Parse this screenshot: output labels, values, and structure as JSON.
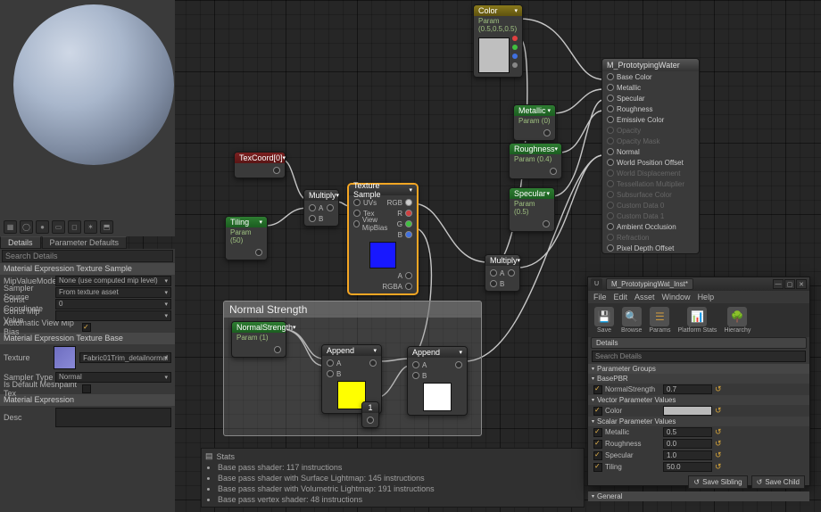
{
  "tabs": {
    "details": "Details",
    "param_defaults": "Parameter Defaults"
  },
  "search_placeholder": "Search Details",
  "left_panel": {
    "sec_tex_sample": "Material Expression Texture Sample",
    "mip_value_mode": {
      "label": "MipValueMode",
      "value": "None (use computed mip level)"
    },
    "sampler_source": {
      "label": "Sampler Source",
      "value": "From texture asset"
    },
    "const_coord": {
      "label": "Const Coordinate",
      "value": "0"
    },
    "const_mip": {
      "label": "Const Mip Value",
      "value": ""
    },
    "auto_view_mip": {
      "label": "Automatic View Mip Bias",
      "checked": true
    },
    "sec_tex_base": "Material Expression Texture Base",
    "texture": {
      "label": "Texture",
      "value": "Fabric01Trim_detailnormal"
    },
    "sampler_type": {
      "label": "Sampler Type",
      "value": "Normal"
    },
    "is_default_meshpaint": {
      "label": "Is Default Meshpaint Tex",
      "checked": false
    },
    "sec_mat_expr": "Material Expression",
    "desc": {
      "label": "Desc"
    }
  },
  "nodes": {
    "color": {
      "title": "Color",
      "sub": "Param (0.5,0.5,0.5)"
    },
    "metallic": {
      "title": "Metallic",
      "sub": "Param (0)"
    },
    "roughness": {
      "title": "Roughness",
      "sub": "Param (0.4)"
    },
    "specular": {
      "title": "Specular",
      "sub": "Param (0.5)"
    },
    "texcoord": {
      "title": "TexCoord[0]"
    },
    "tiling": {
      "title": "Tiling",
      "sub": "Param (50)"
    },
    "multiply1": {
      "title": "Multiply"
    },
    "multiply2": {
      "title": "Multiply"
    },
    "texsample": {
      "title": "Texture Sample",
      "in": [
        "UVs",
        "Tex",
        "View MipBias"
      ],
      "out": [
        "RGB",
        "R",
        "G",
        "B",
        "A",
        "RGBA"
      ]
    },
    "normstr": {
      "title": "NormalStrength",
      "sub": "Param (1)"
    },
    "append1": {
      "title": "Append"
    },
    "append2": {
      "title": "Append"
    },
    "one": {
      "title": "1"
    },
    "groupbox": "Normal Strength"
  },
  "result": {
    "title": "M_PrototypingWater",
    "pins": [
      "Base Color",
      "Metallic",
      "Specular",
      "Roughness",
      "Emissive Color",
      "Opacity",
      "Opacity Mask",
      "Normal",
      "World Position Offset",
      "World Displacement",
      "Tessellation Multiplier",
      "Subsurface Color",
      "Custom Data 0",
      "Custom Data 1",
      "Ambient Occlusion",
      "Refraction",
      "Pixel Depth Offset"
    ],
    "disabled": [
      5,
      6,
      9,
      10,
      11,
      12,
      13,
      15
    ]
  },
  "stats": {
    "title": "Stats",
    "lines": [
      "Base pass shader: 117 instructions",
      "Base pass shader with Surface Lightmap: 145 instructions",
      "Base pass shader with Volumetric Lightmap: 191 instructions",
      "Base pass vertex shader: 48 instructions"
    ]
  },
  "instance": {
    "tab_title": "M_PrototypingWat_Inst*",
    "menu": [
      "File",
      "Edit",
      "Asset",
      "Window",
      "Help"
    ],
    "toolbar": [
      "Save",
      "Browse",
      "Params",
      "Platform Stats",
      "Hierarchy"
    ],
    "details_tab": "Details",
    "search_placeholder": "Search Details",
    "cat_param_groups": "Parameter Groups",
    "cat_basepbr": "BasePBR",
    "rows": {
      "normal_strength": {
        "label": "NormalStrength",
        "value": "0.7"
      },
      "vector_group": "Vector Parameter Values",
      "color": {
        "label": "Color"
      },
      "scalar_group": "Scalar Parameter Values",
      "metallic": {
        "label": "Metallic",
        "value": "0.5"
      },
      "roughness": {
        "label": "Roughness",
        "value": "0.0"
      },
      "specular": {
        "label": "Specular",
        "value": "1.0"
      },
      "tiling": {
        "label": "Tiling",
        "value": "50.0"
      }
    },
    "save_sibling": "Save Sibling",
    "save_child": "Save Child",
    "cat_general": "General"
  }
}
